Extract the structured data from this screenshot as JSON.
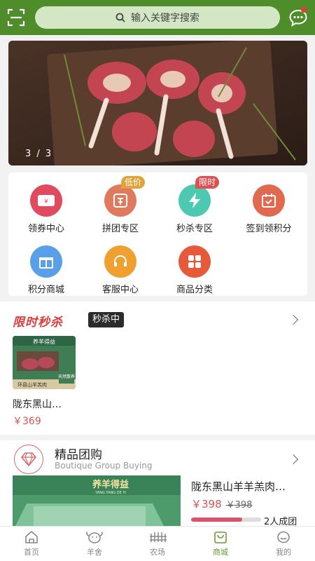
{
  "search": {
    "placeholder": "输入关键字搜索"
  },
  "banner": {
    "indicator": "3 / 3"
  },
  "menu": {
    "row1": [
      {
        "label": "领券中心",
        "icon": "coupon-icon",
        "color": "#e04b5f"
      },
      {
        "label": "拼团专区",
        "icon": "group-buy-icon",
        "color": "#e07a5f",
        "tag": "低价"
      },
      {
        "label": "秒杀专区",
        "icon": "flash-icon",
        "color": "#4cc9b0",
        "tag": "限时"
      },
      {
        "label": "签到领积分",
        "icon": "calendar-icon",
        "color": "#e06a4f"
      }
    ],
    "row2": [
      {
        "label": "积分商城",
        "icon": "gift-icon",
        "color": "#5aa0e8"
      },
      {
        "label": "客服中心",
        "icon": "headset-icon",
        "color": "#f0a02e"
      },
      {
        "label": "商品分类",
        "icon": "category-icon",
        "color": "#e65a3a"
      }
    ]
  },
  "flash_sale": {
    "title": "限时秒杀",
    "status": "秒杀中",
    "product": {
      "name": "陇东黑山…",
      "price": "￥369",
      "image_text": {
        "brand": "养羊得益",
        "badge": "天然散养",
        "caption": "环县山羊羔肉"
      }
    }
  },
  "group_buy": {
    "title": "精品团购",
    "subtitle": "Boutique Group Buying",
    "product": {
      "name": "陇东黑山羊羊羔肉…",
      "price": "￥398",
      "old_price": "￥398",
      "progress": 0.73,
      "count_text": "2人成团",
      "image_brand": "养羊得益",
      "image_sub": "YANG YANG DE YI"
    }
  },
  "tabs": [
    {
      "label": "首页",
      "icon": "home-icon",
      "active": false
    },
    {
      "label": "羊舍",
      "icon": "sheep-icon",
      "active": false
    },
    {
      "label": "农场",
      "icon": "farm-icon",
      "active": false
    },
    {
      "label": "商城",
      "icon": "mall-icon",
      "active": true
    },
    {
      "label": "我的",
      "icon": "profile-icon",
      "active": false
    }
  ],
  "colors": {
    "primary": "#4f8d2b",
    "accent": "#d9534f",
    "tab_active": "#6a9a3a"
  }
}
